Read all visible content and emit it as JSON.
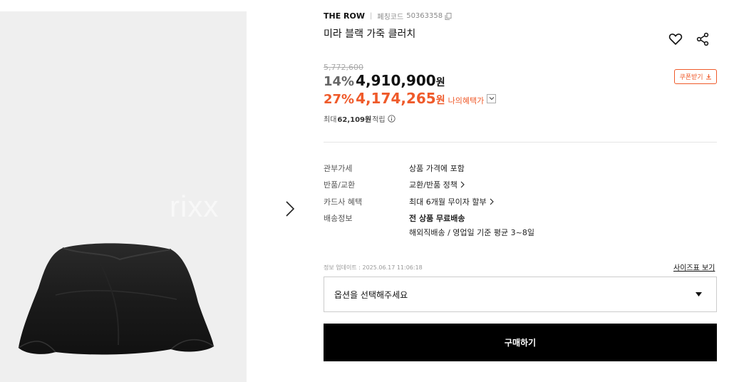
{
  "gallery": {
    "watermark": "rixx"
  },
  "product": {
    "brand": "THE ROW",
    "code_label": "페칭코드",
    "code": "50363358",
    "title": "미라 블랙 가죽 클러치"
  },
  "pricing": {
    "original": "5,772,600",
    "discount1": "14%",
    "price1": "4,910,900",
    "won1": "원",
    "discount2": "27%",
    "price2": "4,174,265",
    "won2": "원",
    "my_benefit_label": "나의혜택가",
    "coupon_label": "쿠폰받기",
    "points_prefix": "최대",
    "points_amount": "62,109원",
    "points_suffix": "적립"
  },
  "specs": [
    {
      "label": "관부가세",
      "value": "상품 가격에 포함"
    },
    {
      "label": "반품/교환",
      "value": "교환/반품 정책"
    },
    {
      "label": "카드사 혜택",
      "value": "최대 6개월 무이자 할부"
    },
    {
      "label": "배송정보",
      "value": "전 상품 무료배송",
      "sub": "해외직배송 / 영업일 기준 평균 3~8일"
    }
  ],
  "update_info": "정보 업데이트 : 2025.06.17 11:06:18",
  "size_chart_label": "사이즈표 보기",
  "option_placeholder": "옵션을 선택해주세요",
  "buy_label": "구매하기",
  "colors": {
    "accent": "#ef5a2a",
    "buy_bg": "#000000",
    "gallery_bg": "#efefef"
  },
  "icons": [
    "copy-icon",
    "heart-icon",
    "share-icon",
    "download-icon",
    "chevron-down-icon",
    "info-icon",
    "chevron-right-icon",
    "caret-down-icon"
  ]
}
